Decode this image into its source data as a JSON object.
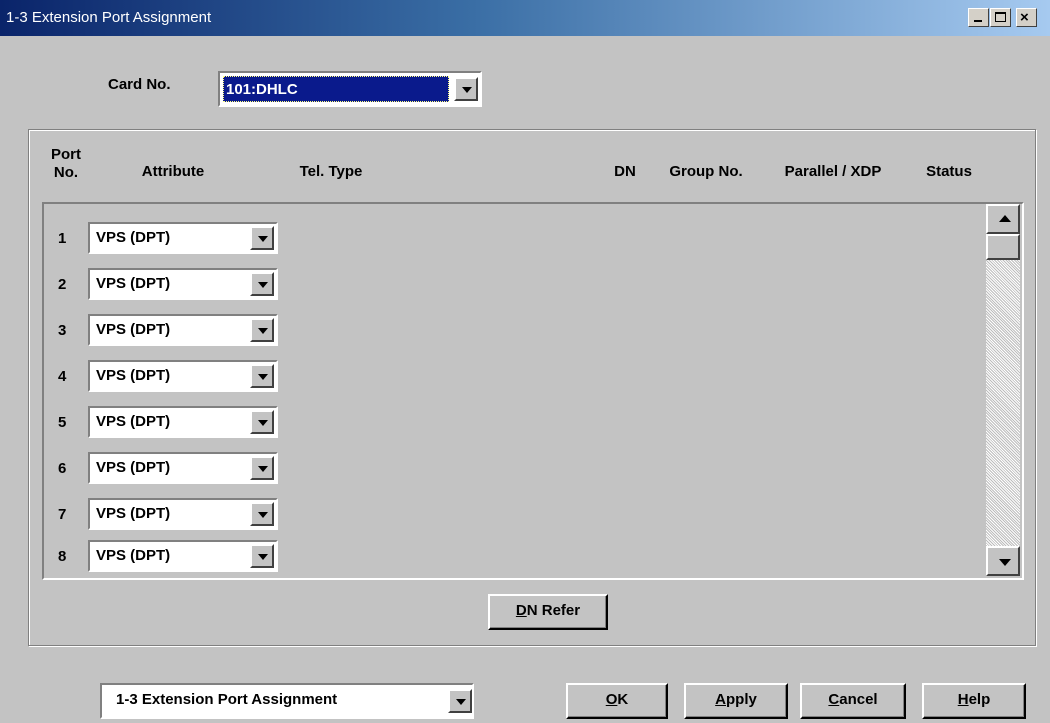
{
  "window": {
    "title": "1-3 Extension Port Assignment"
  },
  "card": {
    "label": "Card No.",
    "selected": "101:DHLC"
  },
  "columns": {
    "port_no": [
      "Port",
      "No."
    ],
    "attribute": "Attribute",
    "tel_type": "Tel. Type",
    "dn": "DN",
    "group_no": "Group No.",
    "parallel_xdp": "Parallel / XDP",
    "status": "Status"
  },
  "rows": [
    {
      "port": "1",
      "attribute": "VPS (DPT)"
    },
    {
      "port": "2",
      "attribute": "VPS (DPT)"
    },
    {
      "port": "3",
      "attribute": "VPS (DPT)"
    },
    {
      "port": "4",
      "attribute": "VPS (DPT)"
    },
    {
      "port": "5",
      "attribute": "VPS (DPT)"
    },
    {
      "port": "6",
      "attribute": "VPS (DPT)"
    },
    {
      "port": "7",
      "attribute": "VPS (DPT)"
    },
    {
      "port": "8",
      "attribute": "VPS (DPT)"
    }
  ],
  "buttons": {
    "dn_refer": {
      "mnemonic": "D",
      "rest": "N Refer"
    },
    "ok": {
      "mnemonic": "O",
      "rest": "K"
    },
    "apply": {
      "mnemonic": "A",
      "rest": "pply"
    },
    "cancel": {
      "mnemonic": "C",
      "rest": "ancel"
    },
    "help": {
      "mnemonic": "H",
      "rest": "elp"
    }
  },
  "nav": {
    "selected": "1-3 Extension Port Assignment"
  },
  "colors": {
    "title_bar_start": "#0a246a",
    "title_bar_end": "#a6caf0",
    "selection": "#0a1a8c",
    "face": "#c3c3c3"
  }
}
